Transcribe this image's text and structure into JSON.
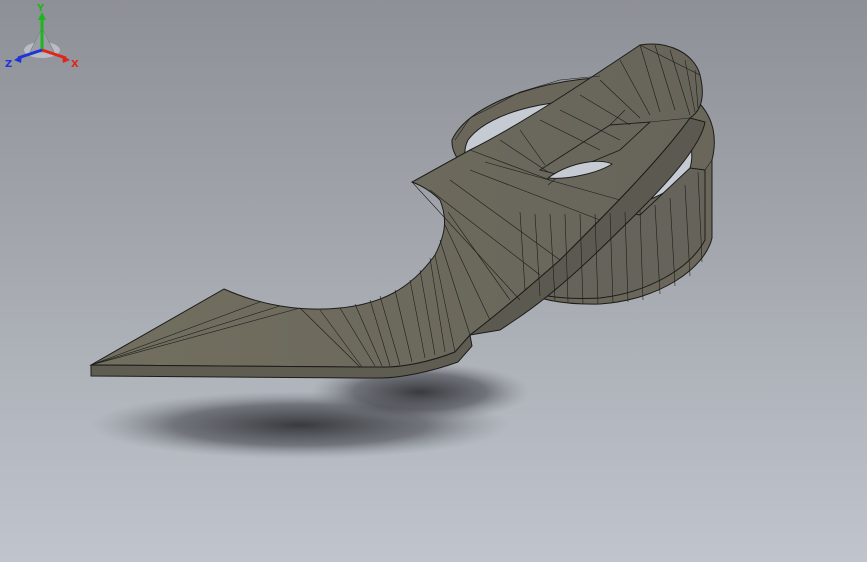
{
  "triad": {
    "x_label": "X",
    "y_label": "Y",
    "z_label": "Z",
    "x_color": "#e0251b",
    "y_color": "#1fb51f",
    "z_color": "#1f34d6"
  },
  "model": {
    "face_color": "#6d6a5c",
    "edge_color": "#1c1c1a"
  }
}
